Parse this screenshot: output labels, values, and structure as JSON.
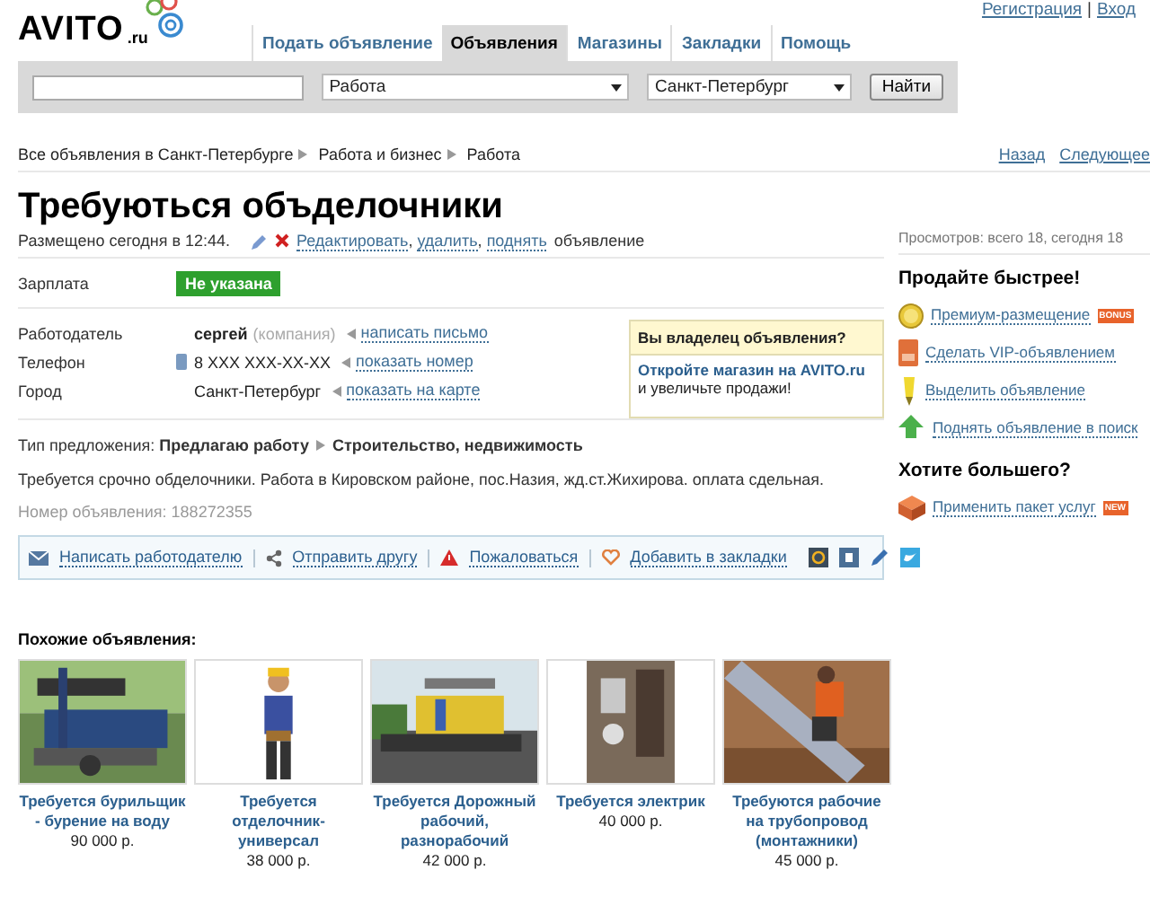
{
  "header": {
    "logo": {
      "name": "AVITO",
      "suffix": ".ru"
    },
    "auth_links": [
      "Регистрация",
      "Вход"
    ],
    "auth_separator": "|",
    "tabs": [
      {
        "label": "Подать объявление",
        "selected": false
      },
      {
        "label": "Объявления",
        "selected": true
      },
      {
        "label": "Магазины",
        "selected": false
      },
      {
        "label": "Закладки",
        "selected": false
      },
      {
        "label": "Помощь",
        "selected": false
      }
    ],
    "search": {
      "category": "Работа",
      "city": "Санкт-Петербург",
      "button": "Найти"
    }
  },
  "breadcrumbs": [
    "Все объявления в Санкт-Петербурге",
    "Работа и бизнес",
    "Работа"
  ],
  "nav_links": [
    "Назад",
    "Следующее"
  ],
  "listing": {
    "title": "Требуються объделочники",
    "posted": "Размещено сегодня в 12:44.",
    "edit_links": [
      "Редактировать",
      "удалить",
      "поднять"
    ],
    "edit_separator": ",",
    "edit_suffix": "объявление",
    "views": "Просмотров: всего 18, сегодня 18",
    "salary": {
      "label": "Зарплата",
      "value": "Не указана"
    },
    "contacts": [
      {
        "label": "Работодатель",
        "value": "сергей",
        "note": "(компания)",
        "action": "написать письмо",
        "kind": "name"
      },
      {
        "label": "Телефон",
        "value": "8 XXX XXX-XX-XX",
        "action": "показать номер",
        "kind": "phone"
      },
      {
        "label": "Город",
        "value": "Санкт-Петербург",
        "action": "показать на карте",
        "kind": "city"
      }
    ],
    "offer_type": {
      "label": "Тип предложения:",
      "values": [
        "Предлагаю работу",
        "Строительство, недвижимость"
      ]
    },
    "description": "Требуется срочно обделочники. Работа в Кировском районе, пос.Назия, жд.ст.Жихирова. оплата сдельная.",
    "ad_number": {
      "label": "Номер объявления:",
      "value": "188272355"
    }
  },
  "owner_box": {
    "title": "Вы владелец объявления?",
    "link": "Откройте магазин на AVITO.ru",
    "text": "и увеличьте продажи!"
  },
  "sidebar": [
    {
      "heading": "Продайте быстрее!",
      "items": [
        {
          "label": "Премиум-размещение",
          "badge": "BONUS",
          "kind": "coin"
        },
        {
          "label": "Сделать VIP-объявлением",
          "kind": "vip"
        },
        {
          "label": "Выделить объявление",
          "kind": "marker"
        },
        {
          "label": "Поднять объявление в поиск",
          "kind": "up"
        }
      ]
    },
    {
      "heading": "Хотите большего?",
      "items": [
        {
          "label": "Применить пакет услуг",
          "badge": "NEW",
          "kind": "box"
        }
      ]
    }
  ],
  "actions": [
    {
      "label": "Написать работодателю",
      "kind": "mail"
    },
    {
      "label": "Отправить другу",
      "kind": "share"
    },
    {
      "label": "Пожаловаться",
      "kind": "warn"
    },
    {
      "label": "Добавить в закладки",
      "kind": "heart"
    }
  ],
  "share_icons": [
    {
      "kind": "mail"
    },
    {
      "kind": "vk"
    },
    {
      "kind": "pen"
    },
    {
      "kind": "twitter"
    }
  ],
  "similar": {
    "heading": "Похожие объявления:",
    "items": [
      {
        "title": "Требуется бурильщик - бурение на воду",
        "price": "90 000 р.",
        "kind": "picture"
      },
      {
        "title": "Требуется отделочник-универсал",
        "price": "38 000 р.",
        "kind": "picture"
      },
      {
        "title": "Требуется Дорожный рабочий, разнорабочий",
        "price": "42 000 р.",
        "kind": "picture"
      },
      {
        "title": "Требуется электрик",
        "price": "40 000 р.",
        "kind": "picture"
      },
      {
        "title": "Требуются рабочие на трубопровод (монтажники)",
        "price": "45 000 р.",
        "kind": "picture"
      }
    ]
  }
}
